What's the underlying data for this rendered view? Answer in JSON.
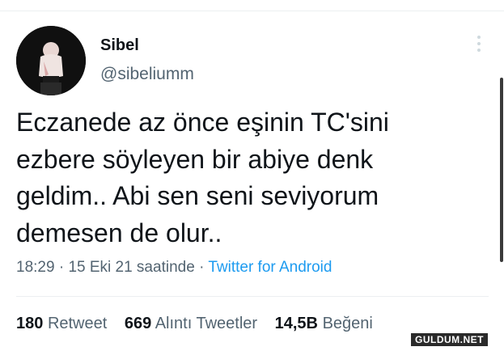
{
  "tweet": {
    "author": {
      "display_name": "Sibel",
      "handle": "@sibeliumm"
    },
    "text_lines": [
      "Eczanede az önce eşinin TC'sini",
      "ezbere söyleyen bir abiye denk",
      "geldim.. Abi sen seni seviyorum",
      "demesen de olur.."
    ],
    "meta": {
      "time": "18:29",
      "separator": "·",
      "date": "15 Eki 21 saatinde",
      "source": "Twitter for Android"
    },
    "stats": [
      {
        "value": "180",
        "label": "Retweet"
      },
      {
        "value": "669",
        "label": "Alıntı Tweetler"
      },
      {
        "value": "14,5B",
        "label": "Beğeni"
      }
    ]
  },
  "icons": {
    "more": "more-options-icon",
    "avatar": "avatar"
  },
  "watermark": "GULDUM.NET",
  "colors": {
    "link": "#1d9bf0",
    "secondary_text": "#536471",
    "primary_text": "#0f1419"
  }
}
